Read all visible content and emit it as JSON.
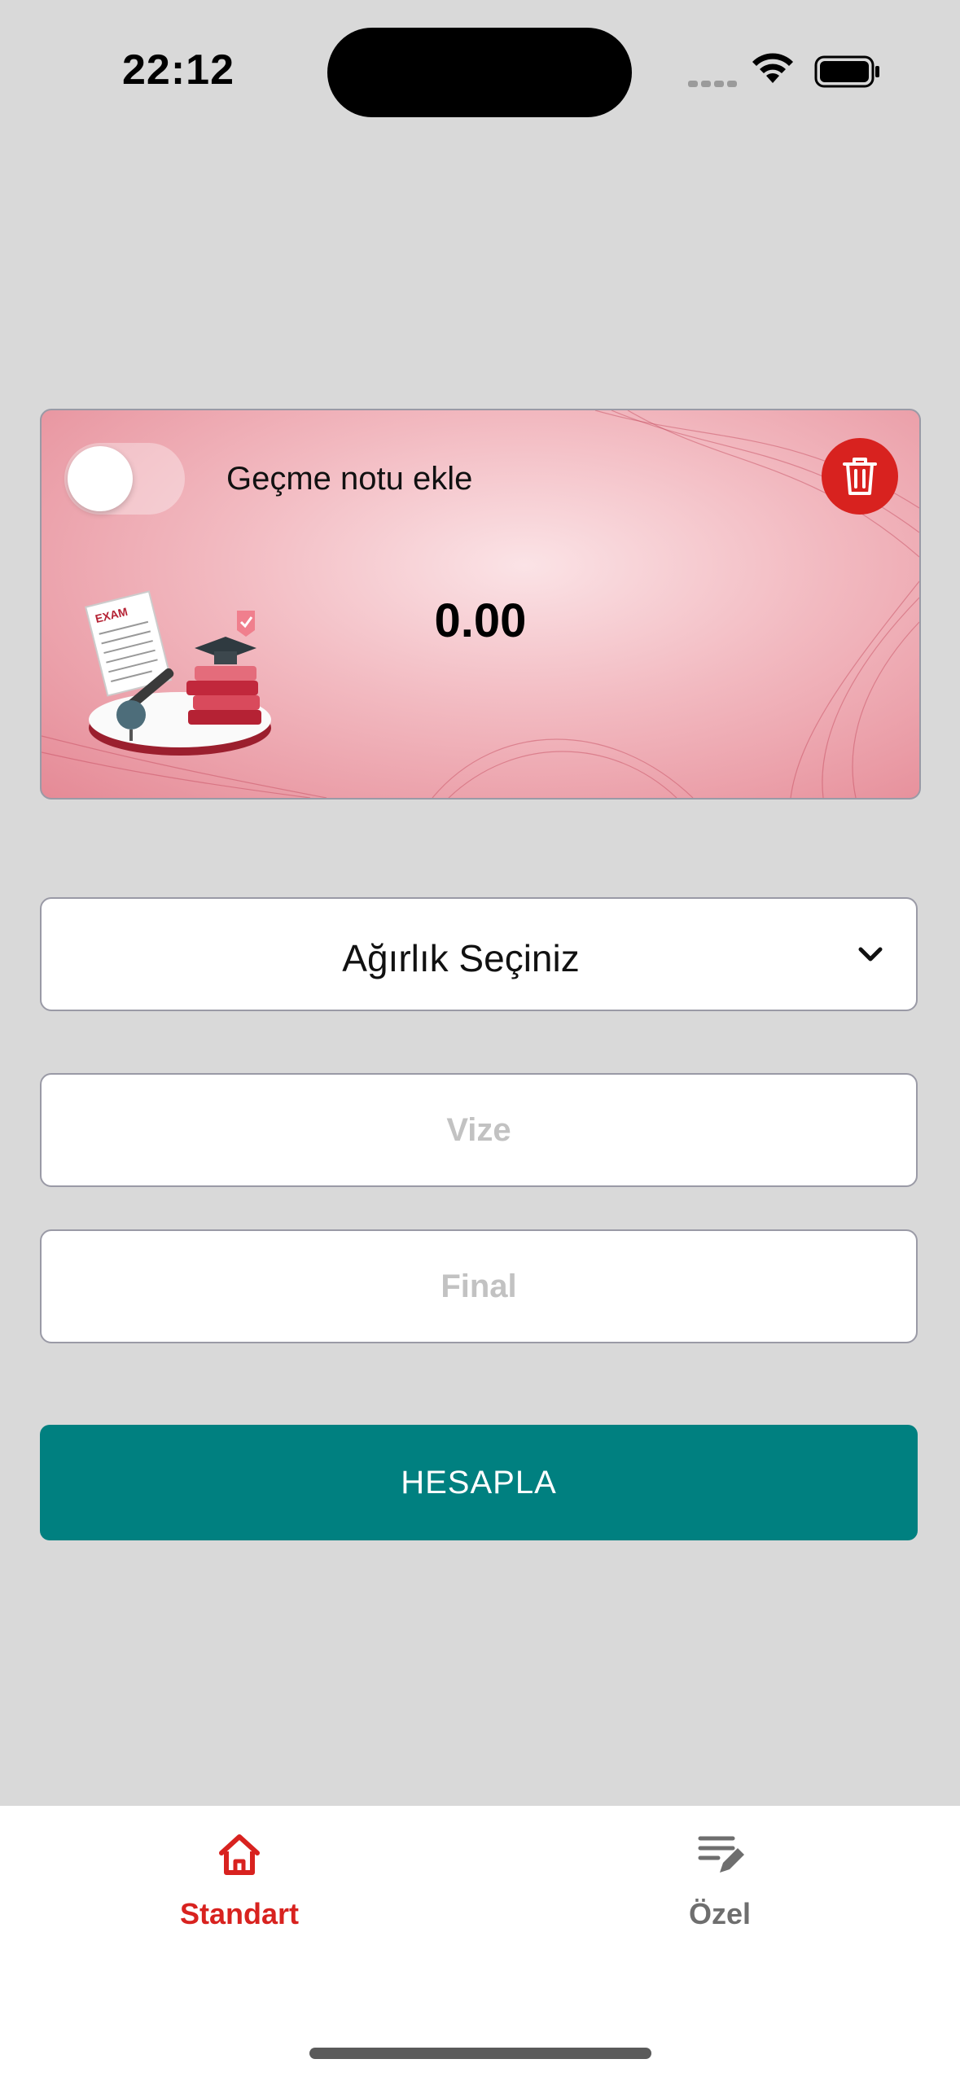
{
  "status_bar": {
    "time": "22:12"
  },
  "card": {
    "toggle_label": "Geçme notu ekle",
    "toggle_on": false,
    "result_value": "0.00"
  },
  "form": {
    "weight_select_label": "Ağırlık Seçiniz",
    "vize_placeholder": "Vize",
    "final_placeholder": "Final",
    "calculate_label": "HESAPLA"
  },
  "tab_bar": {
    "tabs": [
      {
        "label": "Standart",
        "icon": "home-icon",
        "active": true
      },
      {
        "label": "Özel",
        "icon": "edit-list-icon",
        "active": false
      }
    ]
  },
  "colors": {
    "accent_red": "#d8221f",
    "button_teal": "#008080",
    "background": "#d9d9d9"
  }
}
